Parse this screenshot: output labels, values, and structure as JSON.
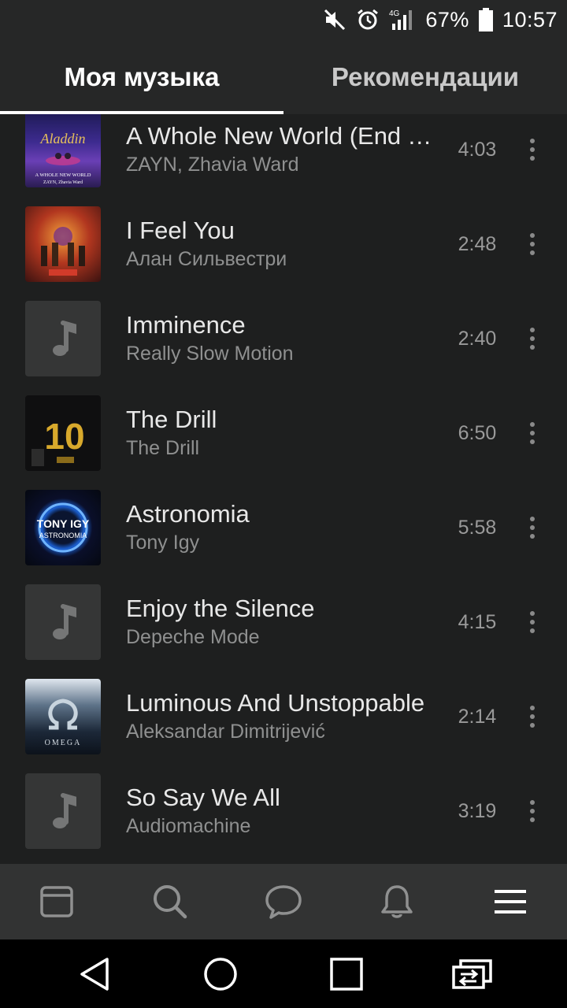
{
  "status_bar": {
    "network": "4G",
    "battery": "67%",
    "time": "10:57"
  },
  "tabs": [
    {
      "label": "Моя музыка",
      "active": true
    },
    {
      "label": "Рекомендации",
      "active": false
    }
  ],
  "tracks": [
    {
      "title": "A Whole New World (End T…",
      "artist": "ZAYN, Zhavia Ward",
      "duration": "4:03",
      "cover": "aladdin-cover",
      "cover_text": "A WHOLE NEW WORLD"
    },
    {
      "title": "I Feel You",
      "artist": "Алан Сильвестри",
      "duration": "2:48",
      "cover": "avengers-cover",
      "cover_text": ""
    },
    {
      "title": "Imminence",
      "artist": "Really Slow Motion",
      "duration": "2:40",
      "cover": "music-note-placeholder",
      "cover_text": ""
    },
    {
      "title": "The Drill",
      "artist": "The Drill",
      "duration": "6:50",
      "cover": "best-of-10-cover",
      "cover_text": "10"
    },
    {
      "title": "Astronomia",
      "artist": "Tony Igy",
      "duration": "5:58",
      "cover": "astronomia-cover",
      "cover_text": "TONY IGY",
      "cover_subtext": "ASTRONOMIA"
    },
    {
      "title": "Enjoy the Silence",
      "artist": "Depeche Mode",
      "duration": "4:15",
      "cover": "music-note-placeholder",
      "cover_text": ""
    },
    {
      "title": "Luminous And Unstoppable",
      "artist": "Aleksandar Dimitrijević",
      "duration": "2:14",
      "cover": "omega-cover",
      "cover_text": "OMEGA"
    },
    {
      "title": "So Say We All",
      "artist": "Audiomachine",
      "duration": "3:19",
      "cover": "music-note-placeholder",
      "cover_text": ""
    }
  ],
  "bottom_nav": [
    "newsfeed-icon",
    "search-icon",
    "messages-icon",
    "notifications-icon",
    "menu-icon"
  ],
  "system_nav": [
    "back-icon",
    "home-icon",
    "recents-icon",
    "dual-window-icon"
  ],
  "colors": {
    "background": "#1e1f1f",
    "header": "#262727",
    "bottom_nav": "#323333",
    "title_text": "#e8e8e8",
    "secondary_text": "#8f9090"
  }
}
